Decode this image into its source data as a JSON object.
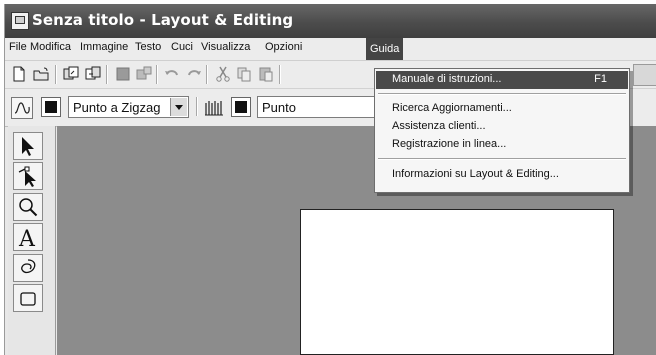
{
  "window": {
    "title": "Senza titolo - Layout & Editing"
  },
  "menubar": {
    "items": [
      {
        "label": "File"
      },
      {
        "label": "Modifica"
      },
      {
        "label": "Immagine"
      },
      {
        "label": "Testo"
      },
      {
        "label": "Cuci"
      },
      {
        "label": "Visualizza"
      },
      {
        "label": "Opzioni"
      },
      {
        "label": "Guida",
        "active": true
      }
    ]
  },
  "toolbar1": {
    "icons": [
      "new-file-icon",
      "open-folder-icon",
      "import-icon",
      "export-icon",
      "grid-icon",
      "image-icon",
      "undo-icon",
      "redo-icon",
      "cut-icon",
      "copy-icon",
      "paste-icon"
    ]
  },
  "toolbar2": {
    "line_style_icon": "line-style-icon",
    "stitch_select": "Punto a Zigzag",
    "region_icon": "region-stitch-icon",
    "second_select_partial": "Punto"
  },
  "toolbox": {
    "tools": [
      "select-arrow-icon",
      "point-edit-icon",
      "zoom-icon",
      "text-icon",
      "shape-icon",
      "rectangle-icon"
    ],
    "text_tool_glyph": "A"
  },
  "guida_menu": {
    "items": [
      {
        "label": "Manuale di istruzioni...",
        "shortcut": "F1",
        "highlighted": true
      },
      {
        "label": "Ricerca Aggiornamenti..."
      },
      {
        "label": "Assistenza clienti..."
      },
      {
        "label": "Registrazione in linea..."
      },
      {
        "label": "Informazioni su Layout & Editing..."
      }
    ]
  },
  "colors": {
    "titlebar": "#4c4c4c",
    "workspace": "#8c8c8c",
    "menu_highlight": "#4a4a4a"
  }
}
